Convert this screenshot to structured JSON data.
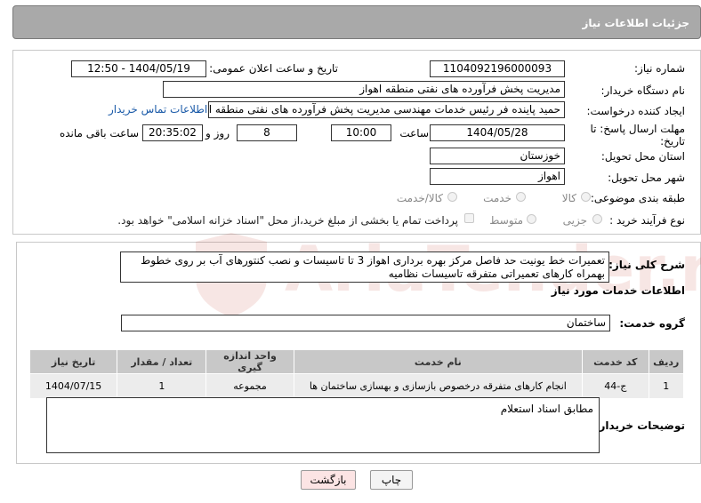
{
  "header": {
    "title": "جزئیات اطلاعات نیاز"
  },
  "form": {
    "need_number_label": "شماره نیاز:",
    "need_number": "1104092196000093",
    "announce_label": "تاریخ و ساعت اعلان عمومی:",
    "announce_value": "1404/05/19 - 12:50",
    "buyer_org_label": "نام دستگاه خریدار:",
    "buyer_org": "مدیریت پخش فرآورده های نفتی منطقه اهواز",
    "creator_label": "ایجاد کننده درخواست:",
    "creator": "حمید پاینده فر رئیس خدمات مهندسی مدیریت پخش فرآورده های نفتی منطقه ا",
    "contact_link": "اطلاعات تماس خریدار",
    "deadline_label_1": "مهلت ارسال پاسخ: تا",
    "deadline_label_2": "تاریخ:",
    "deadline_date": "1404/05/28",
    "time_label": "ساعت",
    "deadline_time": "10:00",
    "days_value": "8",
    "days_label": "روز و",
    "remaining_time": "20:35:02",
    "remaining_label": "ساعت باقی مانده",
    "province_label": "استان محل تحویل:",
    "province": "خوزستان",
    "city_label": "شهر محل تحویل:",
    "city": "اهواز",
    "category_label": "طبقه بندی موضوعی:",
    "category_options": [
      "کالا",
      "خدمت",
      "کالا/خدمت"
    ],
    "process_label": "نوع فرآیند خرید :",
    "process_options": [
      "جزیی",
      "متوسط"
    ],
    "payment_note": "پرداخت تمام یا بخشی از مبلغ خرید،از محل \"اسناد خزانه اسلامی\" خواهد بود."
  },
  "description": {
    "label": "شرح کلی نیاز:",
    "text": "تعمیرات  خط یونیت حد فاصل مرکز بهره برداری اهواز 3 تا تاسیسات و نصب کنتورهای آب بر روی خطوط   بهمراه کارهای تعمیراتی متفرقه تاسیسات نظامیه"
  },
  "services": {
    "section_title": "اطلاعات خدمات مورد نیاز",
    "group_label": "گروه خدمت:",
    "group_value": "ساختمان",
    "columns": [
      "ردیف",
      "کد خدمت",
      "نام خدمت",
      "واحد اندازه گیری",
      "تعداد / مقدار",
      "تاریخ نیاز"
    ],
    "rows": [
      [
        "1",
        "ج-44",
        "انجام کارهای متفرقه درخصوص بازسازی و بهسازی ساختمان ها",
        "مجموعه",
        "1",
        "1404/07/15"
      ]
    ]
  },
  "buyer_notes": {
    "label": "توضیحات خریدار:",
    "text": "مطابق اسناد استعلام"
  },
  "buttons": {
    "print": "چاپ",
    "back": "بازگشت"
  },
  "watermark": {
    "text": "AriaTender.neT"
  },
  "colors": {
    "header_bg": "#a9a9a9",
    "link": "#1a5aa8",
    "table_header": "#c8c8c8",
    "back_button": "#fce4e4"
  }
}
